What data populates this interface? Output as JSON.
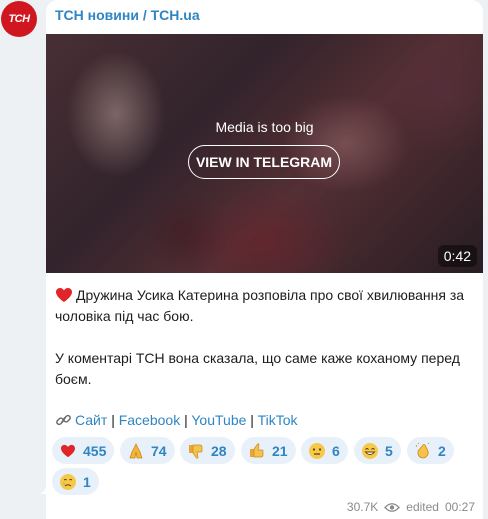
{
  "channel": {
    "avatar_text": "ТСН",
    "name": "ТСН новини / TCH.ua",
    "brand_color": "#d0161e"
  },
  "media": {
    "message": "Media is too big",
    "button_label": "VIEW IN TELEGRAM",
    "duration": "0:42"
  },
  "post": {
    "para1": "Дружина Усика Катерина розповіла про свої хвилювання за чоловіка під час бою.",
    "para2": "У коментарі ТСН вона сказала, що саме каже коханому перед боєм.",
    "links": {
      "site": "Сайт",
      "sep": "|",
      "facebook": "Facebook",
      "youtube": "YouTube",
      "tiktok": "TikTok"
    }
  },
  "reactions": [
    {
      "icon": "red-heart-icon",
      "count": "455"
    },
    {
      "icon": "folded-hands-icon",
      "count": "74"
    },
    {
      "icon": "thumbs-down-icon",
      "count": "28"
    },
    {
      "icon": "thumbs-up-icon",
      "count": "21"
    },
    {
      "icon": "neutral-face-icon",
      "count": "6"
    },
    {
      "icon": "grinning-face-icon",
      "count": "5"
    },
    {
      "icon": "clapping-hands-icon",
      "count": "2"
    },
    {
      "icon": "crying-face-icon",
      "count": "1"
    }
  ],
  "meta": {
    "views": "30.7K",
    "edited_label": "edited",
    "time": "00:27"
  },
  "colors": {
    "link": "#2f85c3",
    "reaction_bg": "#e8f1fa",
    "background": "#eef1f4"
  }
}
